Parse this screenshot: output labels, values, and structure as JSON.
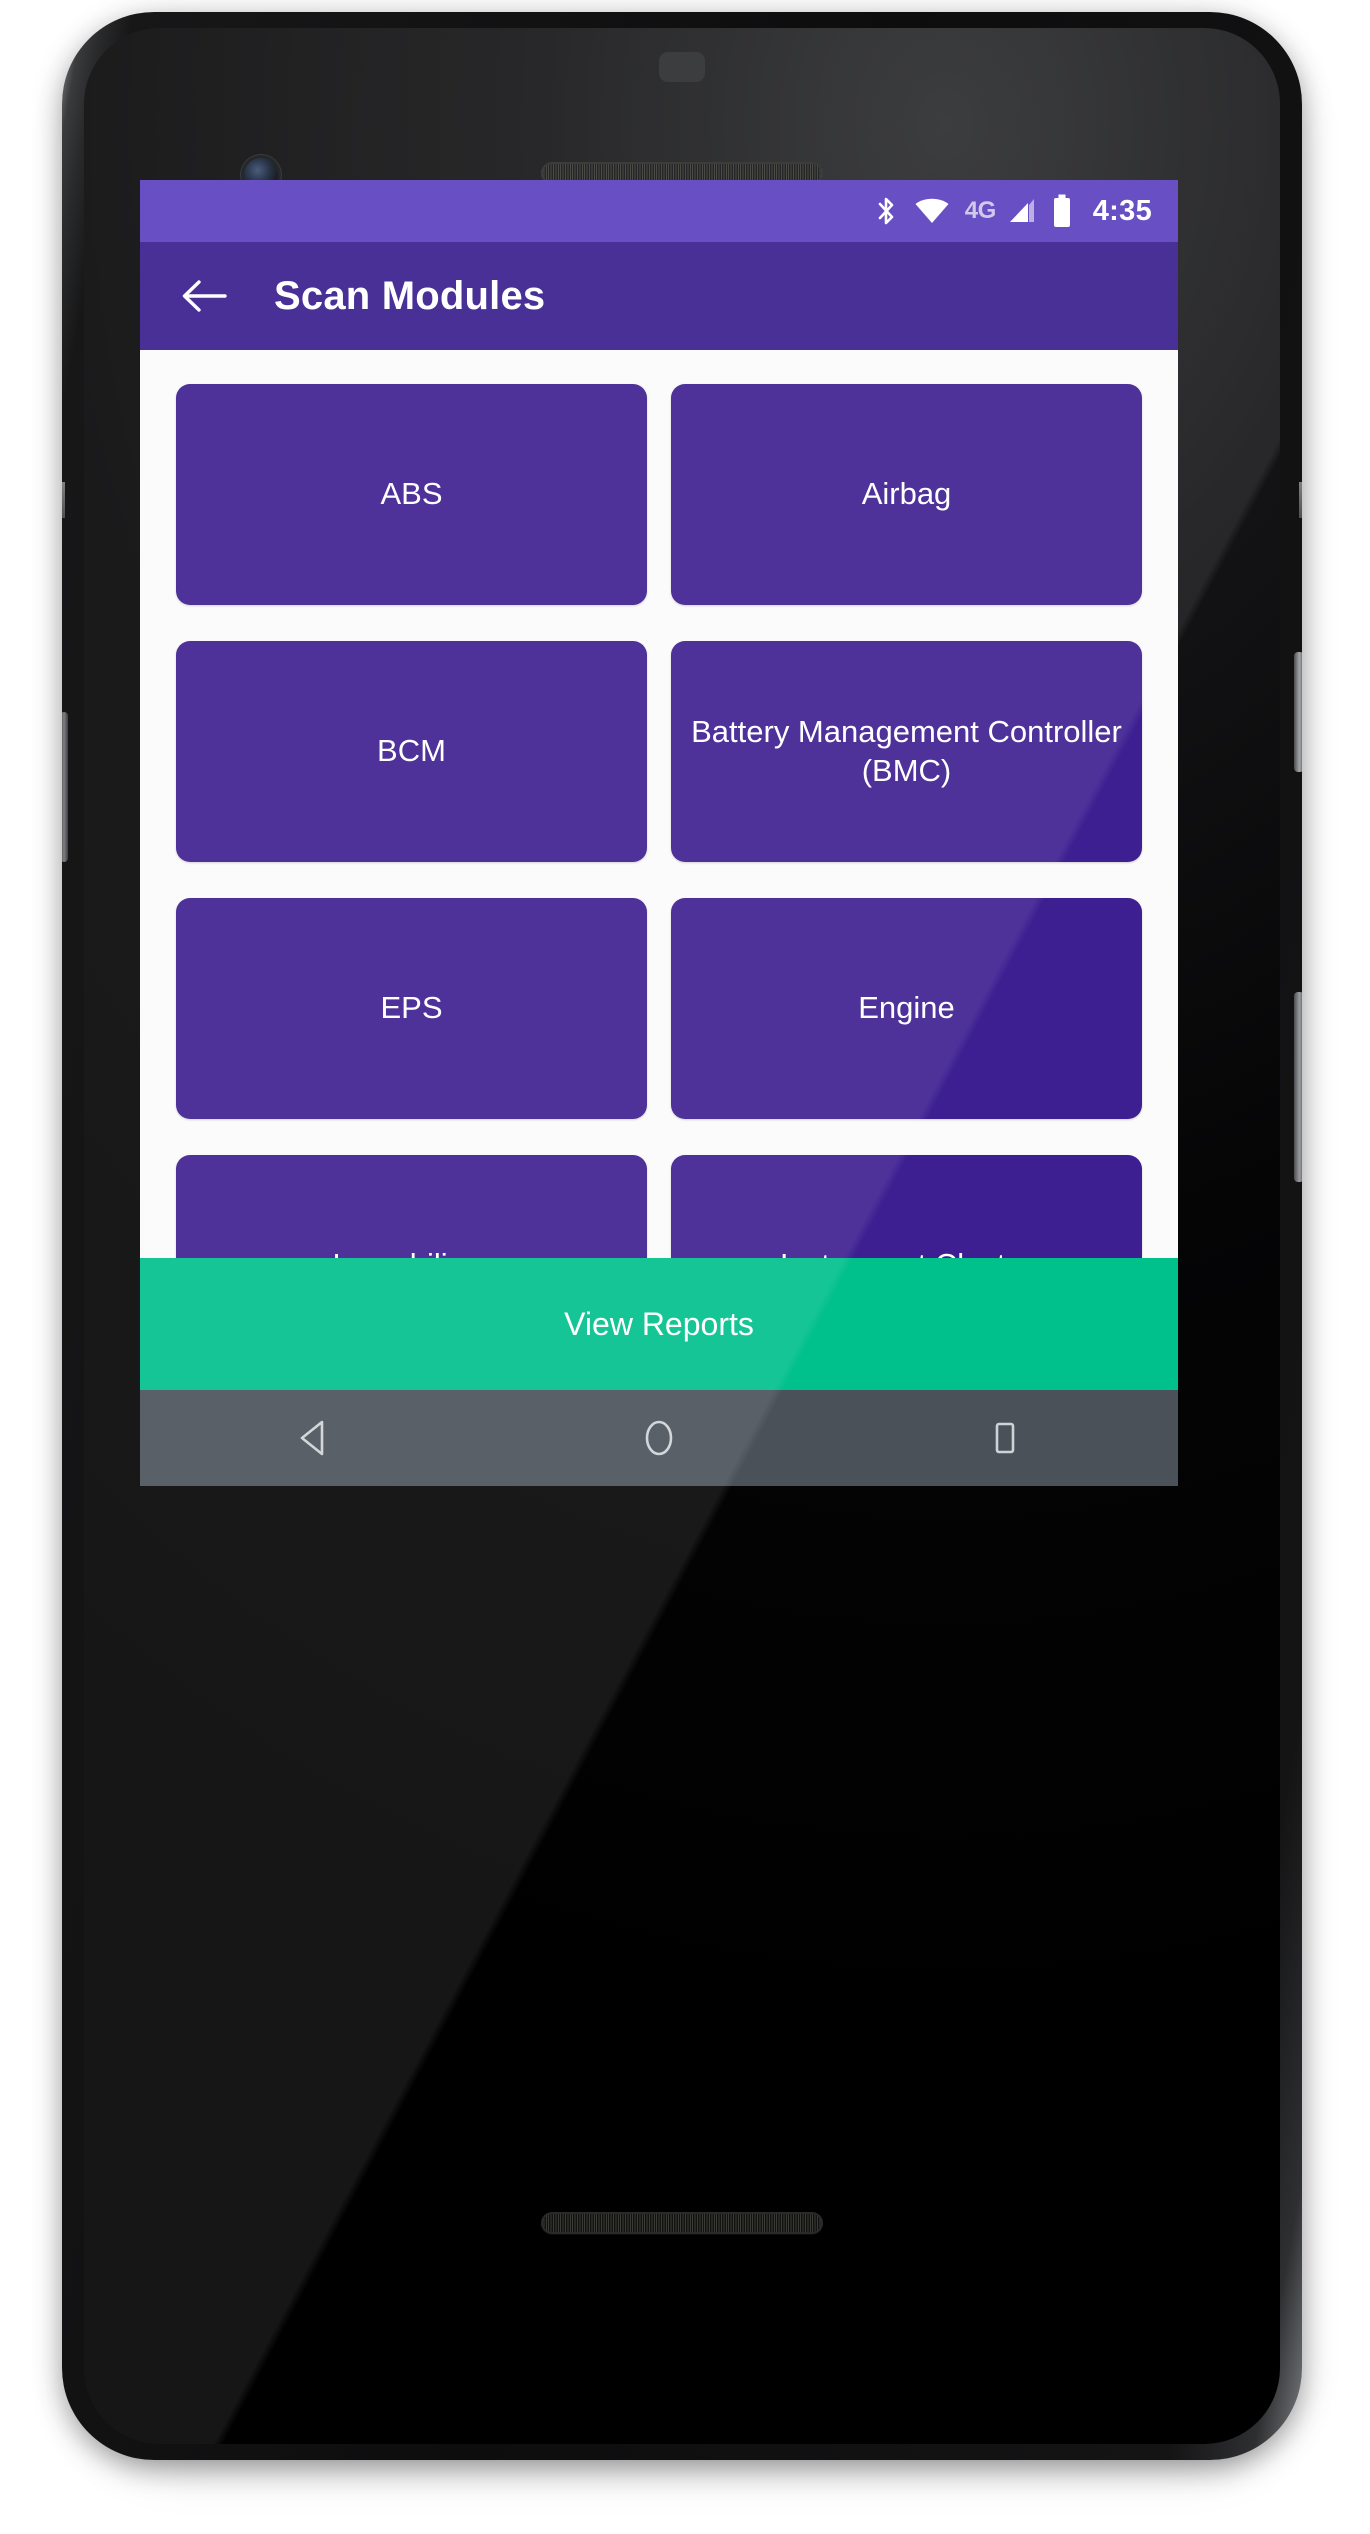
{
  "device": {
    "frame": "pixel-2-black",
    "camera_icon": "front-camera-icon",
    "speaker_icon": "speaker-grille-icon"
  },
  "colors": {
    "status_bar": "#5a3fbe",
    "app_bar": "#371c8c",
    "module_button": "#3d1f91",
    "accent_green": "#00c08b",
    "nav_bar": "#4a5159",
    "screen_background": "#fbfbfb",
    "text_on_dark": "#ffffff",
    "status_4g_text": "#cdc4e8"
  },
  "status_bar": {
    "bluetooth_icon": "bluetooth-icon",
    "wifi_icon": "wifi-icon",
    "network_type": "4G",
    "signal_icon": "cellular-signal-icon",
    "battery_icon": "battery-full-icon",
    "time": "4:35"
  },
  "app_bar": {
    "back_icon": "back-arrow-icon",
    "title": "Scan Modules"
  },
  "modules": [
    {
      "label": "ABS"
    },
    {
      "label": "Airbag"
    },
    {
      "label": "BCM"
    },
    {
      "label": "Battery Management Controller (BMC)"
    },
    {
      "label": "EPS"
    },
    {
      "label": "Engine"
    },
    {
      "label": "Immobilizer"
    },
    {
      "label": "Instrument Cluster"
    },
    {
      "label": ""
    },
    {
      "label": ""
    }
  ],
  "bottom_action": {
    "label": "View Reports"
  },
  "nav_bar": {
    "back_icon": "nav-back-triangle-icon",
    "home_icon": "nav-home-circle-icon",
    "recents_icon": "nav-recents-square-icon"
  }
}
